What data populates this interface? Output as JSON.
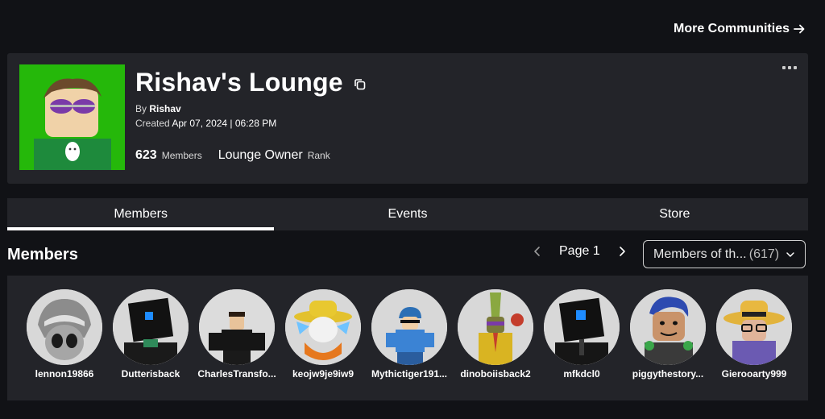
{
  "top_link": {
    "label": "More Communities"
  },
  "community": {
    "name": "Rishav's Lounge",
    "by_label": "By",
    "owner": "Rishav",
    "created_label": "Created",
    "created_value": "Apr 07, 2024 | 06:28 PM",
    "member_count": "623",
    "member_label": "Members",
    "rank_value": "Lounge Owner",
    "rank_label": "Rank"
  },
  "tabs": [
    {
      "label": "Members",
      "active": true
    },
    {
      "label": "Events",
      "active": false
    },
    {
      "label": "Store",
      "active": false
    }
  ],
  "members_section": {
    "title": "Members",
    "page_label": "Page 1",
    "filter_label": "Members of th...",
    "filter_count": "(617)"
  },
  "members": [
    {
      "name": "lennon19866",
      "color": "#8c8c8c"
    },
    {
      "name": "Dutterisback",
      "color": "#121212"
    },
    {
      "name": "CharlesTransfo...",
      "color": "#1a1a1a"
    },
    {
      "name": "keojw9je9iw9",
      "color": "#e3c12d"
    },
    {
      "name": "Mythictiger191...",
      "color": "#2b6fb5"
    },
    {
      "name": "dinoboiisback2",
      "color": "#d9b422"
    },
    {
      "name": "mfkdcl0",
      "color": "#111111"
    },
    {
      "name": "piggythestory...",
      "color": "#2d4ab0"
    },
    {
      "name": "Gierooarty999",
      "color": "#e2b33c"
    }
  ],
  "icons": {
    "arrow": "arrow-right-icon",
    "copy": "copy-icon",
    "more": "more-options-icon",
    "prev": "chevron-left-icon",
    "next": "chevron-right-icon",
    "dropdown": "chevron-down-icon"
  },
  "colors": {
    "background": "#111216",
    "card": "#232429",
    "brand_green": "#25b80a"
  }
}
